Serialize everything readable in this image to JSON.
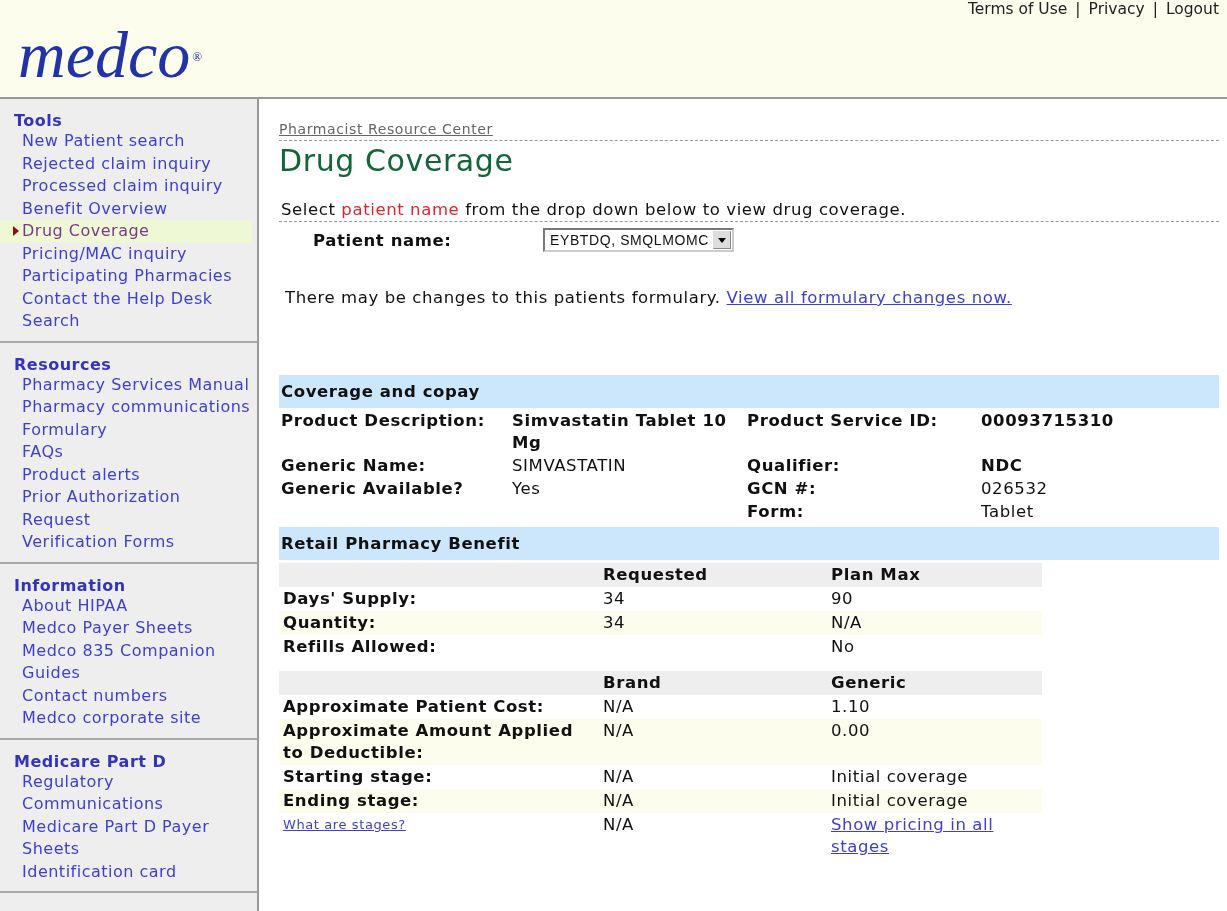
{
  "top_links": {
    "separator": "|",
    "items": [
      "Terms of Use",
      "Privacy",
      "Logout"
    ]
  },
  "logo": {
    "text": "medco",
    "mark": "®"
  },
  "sidebar": [
    {
      "title": "Tools",
      "items": [
        {
          "label": "New Patient search",
          "selected": false
        },
        {
          "label": "Rejected claim inquiry",
          "selected": false
        },
        {
          "label": "Processed claim inquiry",
          "selected": false
        },
        {
          "label": "Benefit Overview",
          "selected": false
        },
        {
          "label": "Drug Coverage",
          "selected": true
        },
        {
          "label": "Pricing/MAC inquiry",
          "selected": false
        },
        {
          "label": "Participating Pharmacies",
          "selected": false
        },
        {
          "label": "Contact the Help Desk",
          "selected": false
        },
        {
          "label": "Search",
          "selected": false
        }
      ]
    },
    {
      "title": "Resources",
      "items": [
        {
          "label": "Pharmacy Services Manual",
          "selected": false
        },
        {
          "label": "Pharmacy communications",
          "selected": false
        },
        {
          "label": "Formulary",
          "selected": false
        },
        {
          "label": "FAQs",
          "selected": false
        },
        {
          "label": "Product alerts",
          "selected": false
        },
        {
          "label": "Prior Authorization Request",
          "selected": false
        },
        {
          "label": "Verification Forms",
          "selected": false
        }
      ]
    },
    {
      "title": "Information",
      "items": [
        {
          "label": "About HIPAA",
          "selected": false
        },
        {
          "label": "Medco Payer Sheets",
          "selected": false
        },
        {
          "label": "Medco 835 Companion Guides",
          "selected": false
        },
        {
          "label": "Contact numbers",
          "selected": false
        },
        {
          "label": "Medco corporate site",
          "selected": false
        }
      ]
    },
    {
      "title": "Medicare Part D",
      "items": [
        {
          "label": "Regulatory",
          "selected": false
        },
        {
          "label": "Communications",
          "selected": false
        },
        {
          "label": "Medicare Part D Payer Sheets",
          "selected": false
        },
        {
          "label": "Identification card",
          "selected": false
        }
      ]
    }
  ],
  "breadcrumb": "Pharmacist Resource Center",
  "title": "Drug Coverage",
  "instruction": {
    "before": "Select ",
    "highlight": "patient name",
    "after": " from the drop down below to view drug coverage."
  },
  "patient_field": {
    "label": "Patient name:",
    "value": "EYBTDQ, SMQLMOMC"
  },
  "notice": {
    "text": "There may be changes to this patients formulary.",
    "link": "View all formulary changes now."
  },
  "coverage": {
    "title": "Coverage and copay",
    "rows": [
      {
        "left": {
          "label": "Product Description:",
          "value": "Simvastatin Tablet 10 Mg",
          "bold": true
        },
        "right": {
          "label": "Product Service ID:",
          "value": "00093715310",
          "bold": true
        }
      },
      {
        "left": {
          "label": "Generic Name:",
          "value": "SIMVASTATIN",
          "bold": false
        },
        "right": {
          "label": "Qualifier:",
          "value": "NDC",
          "bold": true
        }
      },
      {
        "left": {
          "label": "Generic Available?",
          "value": "Yes",
          "bold": false
        },
        "right": {
          "label": "GCN #:",
          "value": "026532",
          "bold": false
        }
      },
      {
        "right": {
          "label": "Form:",
          "value": "Tablet",
          "bold": false
        }
      }
    ]
  },
  "retail": {
    "title": "Retail Pharmacy Benefit",
    "tables": [
      {
        "columns": [
          "Requested",
          "Plan Max"
        ],
        "rows": [
          {
            "label": "Days' Supply:",
            "cells": [
              "34",
              "90"
            ]
          },
          {
            "label": "Quantity:",
            "cells": [
              "34",
              "N/A"
            ]
          },
          {
            "label": "Refills Allowed:",
            "cells": [
              "",
              "No"
            ]
          }
        ]
      },
      {
        "columns": [
          "Brand",
          "Generic"
        ],
        "rows": [
          {
            "label": "Approximate Patient Cost:",
            "cells": [
              "N/A",
              "1.10"
            ]
          },
          {
            "label": "Approximate Amount Applied to Deductible:",
            "cells": [
              "N/A",
              "0.00"
            ]
          },
          {
            "label": "Starting stage:",
            "cells": [
              "N/A",
              "Initial coverage"
            ]
          },
          {
            "label": "Ending stage:",
            "cells": [
              "N/A",
              "Initial coverage"
            ]
          },
          {
            "label": "What are stages?",
            "kind": "link",
            "cells": [
              "N/A"
            ],
            "link": "Show pricing in all stages"
          }
        ]
      }
    ]
  }
}
